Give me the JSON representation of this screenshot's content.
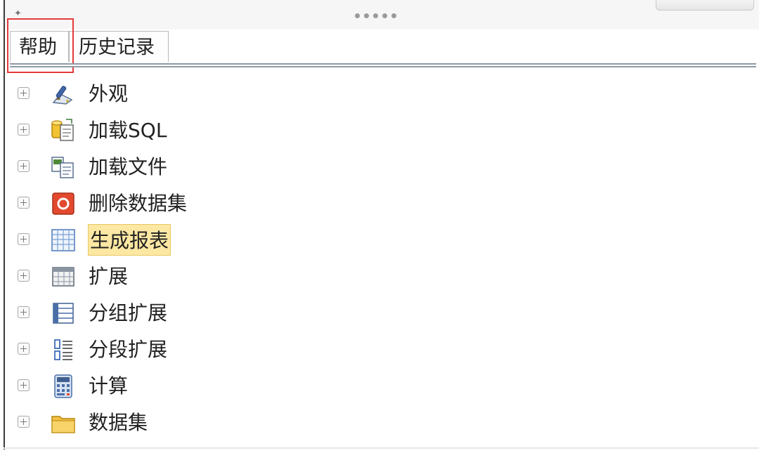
{
  "tabs": [
    {
      "label": "帮助",
      "active": true
    },
    {
      "label": "历史记录",
      "active": false
    }
  ],
  "highlight_color": "#e53a3a",
  "selection_color": "#fde8a3",
  "tree": {
    "items": [
      {
        "label": "外观",
        "icon": "paintbrush-palette-icon"
      },
      {
        "label": "加载SQL",
        "icon": "load-sql-icon"
      },
      {
        "label": "加载文件",
        "icon": "load-file-icon"
      },
      {
        "label": "删除数据集",
        "icon": "delete-dataset-icon"
      },
      {
        "label": "生成报表",
        "icon": "grid-table-icon",
        "selected": true
      },
      {
        "label": "扩展",
        "icon": "table-icon"
      },
      {
        "label": "分组扩展",
        "icon": "grouped-list-icon"
      },
      {
        "label": "分段扩展",
        "icon": "segmented-list-icon"
      },
      {
        "label": "计算",
        "icon": "calculator-icon"
      },
      {
        "label": "数据集",
        "icon": "folder-icon"
      }
    ]
  }
}
